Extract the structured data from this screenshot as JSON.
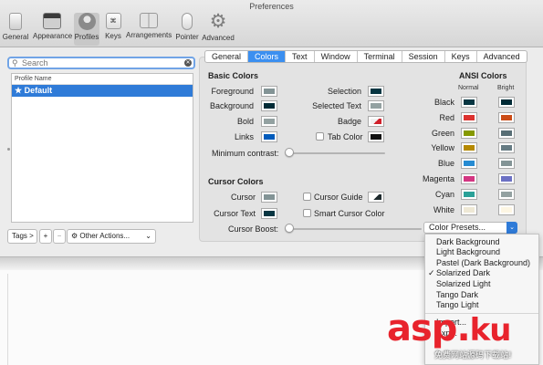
{
  "window": {
    "title": "Preferences"
  },
  "toolbar": [
    {
      "label": "General",
      "icon": "general-icon"
    },
    {
      "label": "Appearance",
      "icon": "appearance-icon"
    },
    {
      "label": "Profiles",
      "icon": "profiles-icon",
      "selected": true
    },
    {
      "label": "Keys",
      "icon": "keys-icon"
    },
    {
      "label": "Arrangements",
      "icon": "arrangements-icon"
    },
    {
      "label": "Pointer",
      "icon": "pointer-icon"
    },
    {
      "label": "Advanced",
      "icon": "advanced-gear-icon"
    }
  ],
  "search": {
    "placeholder": "Search"
  },
  "profiles": {
    "column_header": "Profile Name",
    "items": [
      "★ Default"
    ]
  },
  "profile_controls": {
    "tags": "Tags >",
    "add": "+",
    "remove": "−",
    "other_actions": "Other Actions..."
  },
  "tabs": [
    "General",
    "Colors",
    "Text",
    "Window",
    "Terminal",
    "Session",
    "Keys",
    "Advanced"
  ],
  "active_tab": "Colors",
  "basic_colors": {
    "title": "Basic Colors",
    "left": [
      {
        "label": "Foreground",
        "color": "#839496"
      },
      {
        "label": "Background",
        "color": "#002b36"
      },
      {
        "label": "Bold",
        "color": "#93a1a1"
      },
      {
        "label": "Links",
        "color": "#005bbb"
      }
    ],
    "right": [
      {
        "label": "Selection",
        "color": "#073642"
      },
      {
        "label": "Selected Text",
        "color": "#93a1a1"
      },
      {
        "label": "Badge",
        "color": "#d0202a"
      },
      {
        "label": "Tab Color",
        "color": "#111111"
      }
    ],
    "min_contrast": "Minimum contrast:"
  },
  "cursor_colors": {
    "title": "Cursor Colors",
    "cursor": {
      "label": "Cursor",
      "color": "#839496"
    },
    "cursor_text": {
      "label": "Cursor Text",
      "color": "#073642"
    },
    "cursor_guide": {
      "label": "Cursor Guide",
      "color": "#1f2b2e"
    },
    "smart_cursor": "Smart Cursor Color",
    "cursor_boost": "Cursor Boost:"
  },
  "ansi_colors": {
    "title": "ANSI Colors",
    "normal_header": "Normal",
    "bright_header": "Bright",
    "rows": [
      {
        "name": "Black",
        "normal": "#073642",
        "bright": "#002b36"
      },
      {
        "name": "Red",
        "normal": "#dc322f",
        "bright": "#cb4b16"
      },
      {
        "name": "Green",
        "normal": "#859900",
        "bright": "#586e75"
      },
      {
        "name": "Yellow",
        "normal": "#b58900",
        "bright": "#657b83"
      },
      {
        "name": "Blue",
        "normal": "#268bd2",
        "bright": "#839496"
      },
      {
        "name": "Magenta",
        "normal": "#d33682",
        "bright": "#6c71c4"
      },
      {
        "name": "Cyan",
        "normal": "#2aa198",
        "bright": "#93a1a1"
      },
      {
        "name": "White",
        "normal": "#eee8d5",
        "bright": "#fdf6e3"
      }
    ]
  },
  "presets": {
    "button_label": "Color Presets...",
    "items": [
      "Dark Background",
      "Light Background",
      "Pastel (Dark Background)",
      "Solarized Dark",
      "Solarized Light",
      "Tango Dark",
      "Tango Light"
    ],
    "checked": "Solarized Dark",
    "extra_items": [
      "Import...",
      "Exp..."
    ]
  },
  "watermark": {
    "logo": "asp",
    "logo_tail": "ku",
    "logo_dot": ".",
    "sub": "免费网站源码下载站!"
  }
}
